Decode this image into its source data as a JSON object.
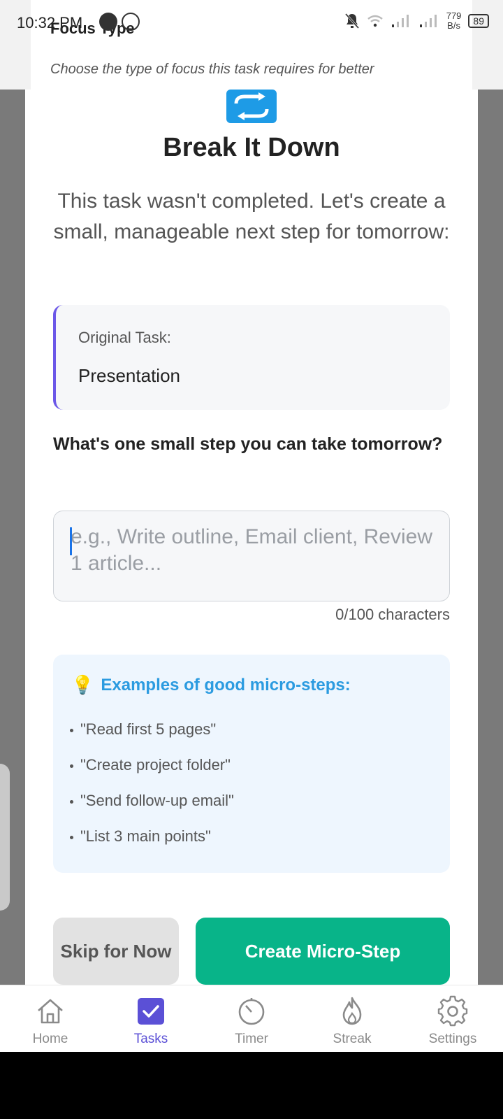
{
  "status_bar": {
    "time": "10:32 PM",
    "net_speed_value": "779",
    "net_speed_unit": "B/s",
    "battery": "89"
  },
  "background": {
    "title": "Focus Type",
    "subtitle": "Choose the type of focus this task requires for better"
  },
  "modal": {
    "title": "Break It Down",
    "description": "This task wasn't completed. Let's create a small, manageable next step for tomorrow:",
    "original_task_label": "Original Task:",
    "original_task_value": "Presentation",
    "question": "What's one small step you can take tomorrow?",
    "input_value": "",
    "input_placeholder": "e.g., Write outline, Email client, Review 1 article...",
    "char_count": "0/100 characters",
    "examples_title": "Examples of good micro-steps:",
    "examples": [
      "\"Read first 5 pages\"",
      "\"Create project folder\"",
      "\"Send follow-up email\"",
      "\"List 3 main points\""
    ],
    "skip_label": "Skip for Now",
    "create_label": "Create Micro-Step"
  },
  "bottom_nav": {
    "items": [
      {
        "label": "Home",
        "icon": "home-icon"
      },
      {
        "label": "Tasks",
        "icon": "checkbox-icon"
      },
      {
        "label": "Timer",
        "icon": "timer-icon"
      },
      {
        "label": "Streak",
        "icon": "flame-icon"
      },
      {
        "label": "Settings",
        "icon": "gear-icon"
      }
    ],
    "active": "Tasks"
  },
  "colors": {
    "accent_purple": "#5b50d6",
    "create_green": "#08b489",
    "examples_blue": "#2b9be0"
  }
}
